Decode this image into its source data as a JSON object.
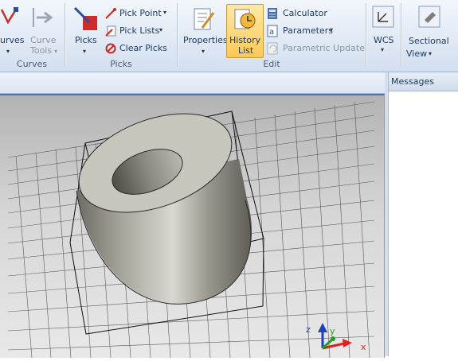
{
  "ribbon": {
    "curves_group": {
      "curves_label": "urves",
      "curve_tools_label": "Curve\nTools",
      "group_label": "Curves"
    },
    "picks_group": {
      "picks_label": "Picks",
      "pick_point_label": "Pick Point",
      "pick_lists_label": "Pick Lists",
      "clear_picks_label": "Clear Picks",
      "group_label": "Picks"
    },
    "edit_group": {
      "properties_label": "Properties",
      "history_list_line1": "History",
      "history_list_line2": "List",
      "calculator_label": "Calculator",
      "parameters_label": "Parameters",
      "parametric_update_label": "Parametric Update",
      "group_label": "Edit"
    },
    "wcs_label": "WCS",
    "sectional_view_line1": "Sectional",
    "sectional_view_line2": "View"
  },
  "messages_panel": {
    "title": "Messages"
  },
  "axes": {
    "x": "x",
    "y": "y",
    "z": "z"
  },
  "colors": {
    "accent": "#4a73b0",
    "highlight": "#fcc955",
    "x_axis": "#e02020",
    "y_axis": "#20a020",
    "z_axis": "#2040c0"
  }
}
